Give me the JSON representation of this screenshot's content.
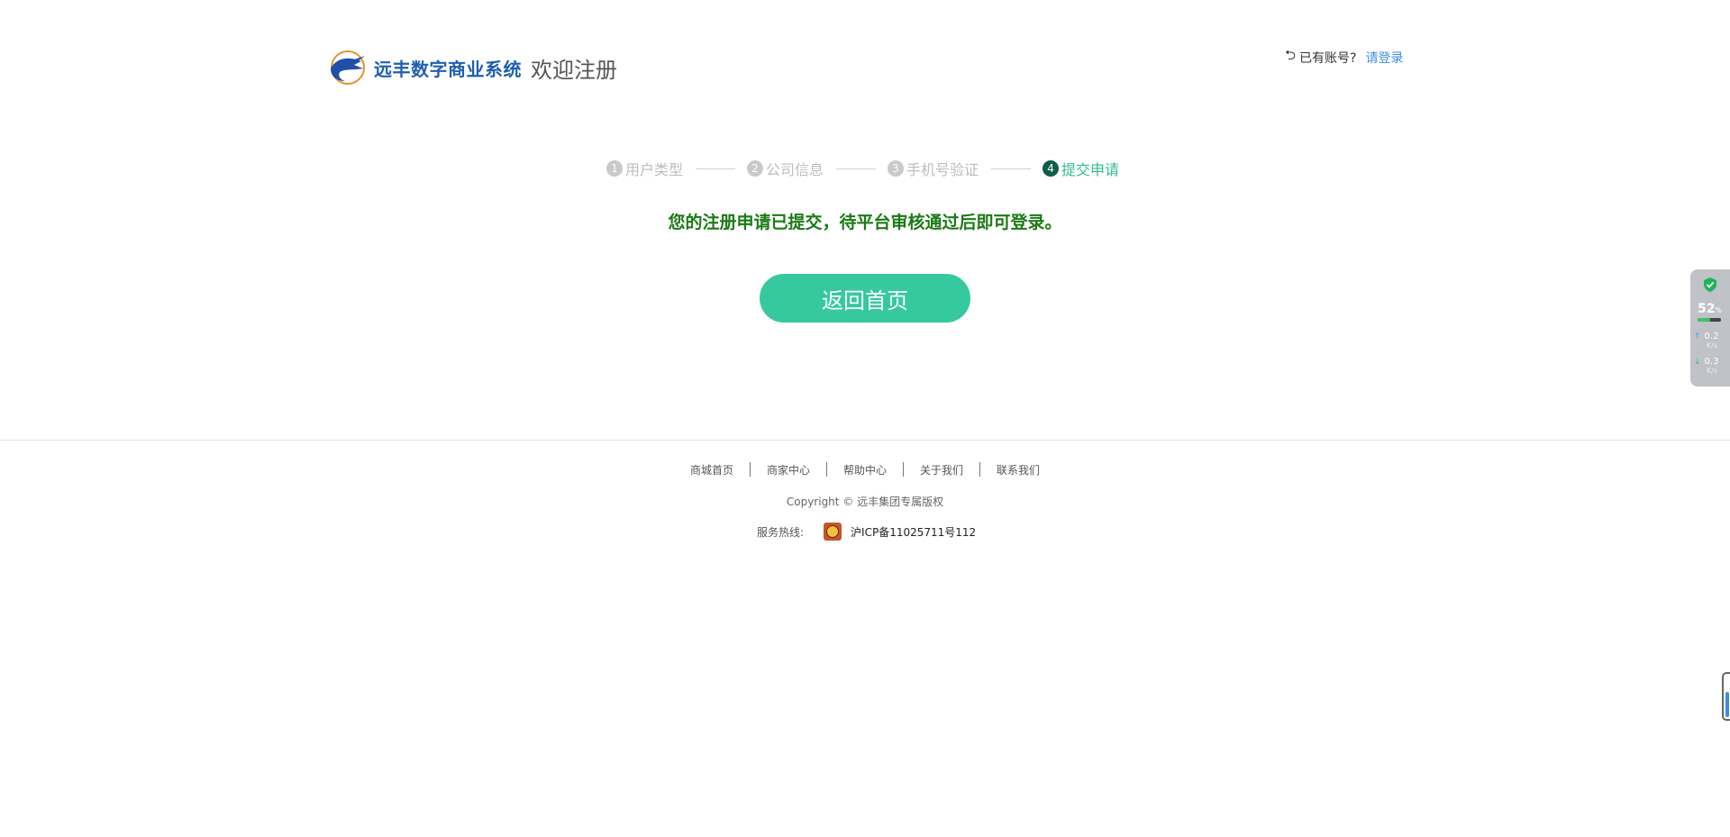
{
  "header": {
    "brand": "远丰数字商业系统",
    "welcome": "欢迎注册",
    "has_account": "已有账号?",
    "login_link": "请登录"
  },
  "steps": [
    {
      "num": "1",
      "label": "用户类型",
      "state": "done"
    },
    {
      "num": "2",
      "label": "公司信息",
      "state": "done"
    },
    {
      "num": "3",
      "label": "手机号验证",
      "state": "done"
    },
    {
      "num": "4",
      "label": "提交申请",
      "state": "active"
    }
  ],
  "message": "您的注册申请已提交，待平台审核通过后即可登录。",
  "home_button": "返回首页",
  "footer": {
    "nav": [
      "商城首页",
      "商家中心",
      "帮助中心",
      "关于我们",
      "联系我们"
    ],
    "copyright": "Copyright © 远丰集团专属版权",
    "hotline": "服务热线:",
    "icp": "沪ICP备11025711号112"
  },
  "widget": {
    "percent": "52",
    "percent_unit": "%",
    "memory_fraction": 0.52,
    "upload": "0.2",
    "download": "0.3",
    "unit": "K/s"
  },
  "colors": {
    "accent": "#36c9a0",
    "success_text": "#1a7a14",
    "link": "#3a8ee6"
  }
}
